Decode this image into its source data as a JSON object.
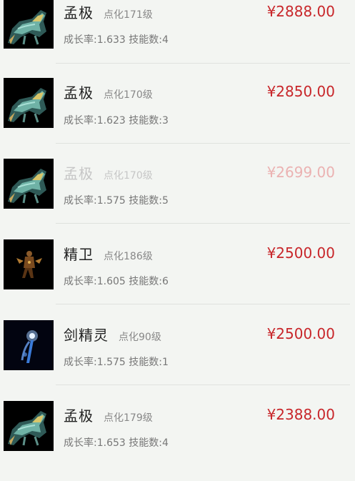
{
  "listings": [
    {
      "name": "孟极",
      "level": "点化171级",
      "price": "¥2888.00",
      "stats": "成长率:1.633 技能数:4",
      "pet": "tiger",
      "faded": false
    },
    {
      "name": "孟极",
      "level": "点化170级",
      "price": "¥2850.00",
      "stats": "成长率:1.623 技能数:3",
      "pet": "tiger",
      "faded": false
    },
    {
      "name": "孟极",
      "level": "点化170级",
      "price": "¥2699.00",
      "stats": "成长率:1.575 技能数:5",
      "pet": "tiger",
      "faded": true
    },
    {
      "name": "精卫",
      "level": "点化186级",
      "price": "¥2500.00",
      "stats": "成长率:1.605 技能数:6",
      "pet": "bird-figure",
      "faded": false
    },
    {
      "name": "剑精灵",
      "level": "点化90级",
      "price": "¥2500.00",
      "stats": "成长率:1.575 技能数:1",
      "pet": "sword-spirit",
      "faded": false
    },
    {
      "name": "孟极",
      "level": "点化179级",
      "price": "¥2388.00",
      "stats": "成长率:1.653 技能数:4",
      "pet": "tiger",
      "faded": false
    }
  ],
  "colors": {
    "background": "#f3f5f2",
    "price": "#c8262a",
    "price_faded": "#ebb2b2",
    "name": "#222222",
    "muted": "#888888"
  }
}
